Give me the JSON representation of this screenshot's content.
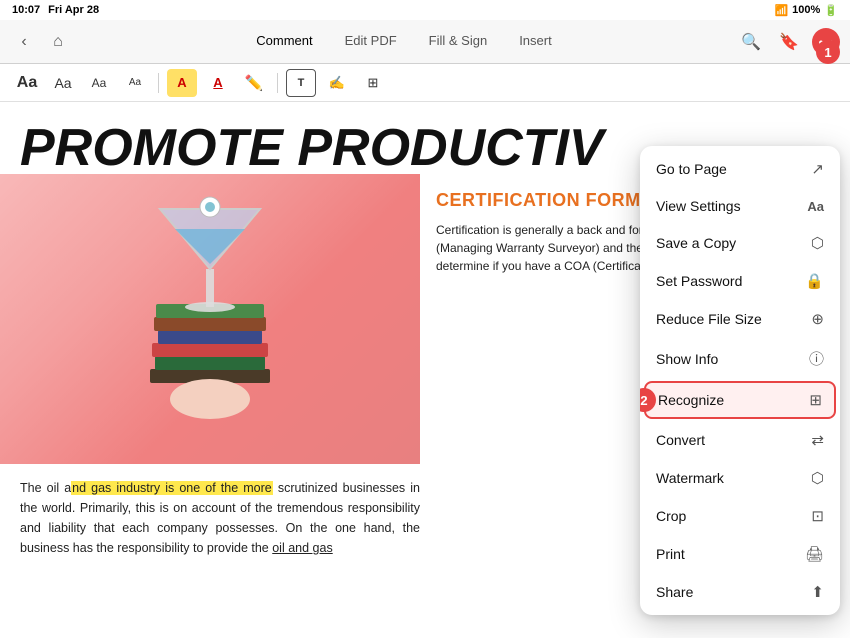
{
  "statusBar": {
    "time": "10:07",
    "day": "Fri Apr 28",
    "battery": "100%",
    "batteryIcon": "🔋"
  },
  "toolbar": {
    "tabs": [
      {
        "id": "comment",
        "label": "Comment",
        "active": true
      },
      {
        "id": "editpdf",
        "label": "Edit PDF",
        "active": false
      },
      {
        "id": "fillsign",
        "label": "Fill & Sign",
        "active": false
      },
      {
        "id": "insert",
        "label": "Insert",
        "active": false
      }
    ],
    "moreButton": "•••"
  },
  "formatBar": {
    "buttons": [
      {
        "id": "aa-large",
        "label": "Aa",
        "size": "large"
      },
      {
        "id": "aa-med",
        "label": "Aa",
        "size": "medium"
      },
      {
        "id": "aa-small",
        "label": "Aa",
        "size": "small"
      },
      {
        "id": "aa-xs",
        "label": "Aa",
        "size": "xsmall"
      },
      {
        "id": "highlight-red",
        "label": "A",
        "type": "color"
      },
      {
        "id": "underline-red",
        "label": "A̲",
        "type": "underline"
      },
      {
        "id": "pencil",
        "label": "✏",
        "type": "draw"
      },
      {
        "id": "text-box",
        "label": "T",
        "type": "textbox"
      },
      {
        "id": "signature",
        "label": "✍",
        "type": "signature"
      },
      {
        "id": "image",
        "label": "⊞",
        "type": "image"
      }
    ]
  },
  "pdf": {
    "title": "PROMOTE PRODUCTIV",
    "bodyText": "The oil and gas industry is one of the more scrutinized businesses in the world. Primarily, this is on account of the tremendous responsibility and liability that each company possesses. On the one hand, the business has the responsibility to provide the oil and gas",
    "highlightedText": "nd gas industry is one of the more",
    "certTitle": "CERTIFICATION FORMS",
    "certText": "Certification is generally a back and forth of fixes between the MWS (Managing Warranty Surveyor) and the insurer. Since the MWS will determine if you have a COA (Certificate"
  },
  "menu": {
    "items": [
      {
        "id": "go-to-page",
        "label": "Go to Page",
        "icon": "⤢"
      },
      {
        "id": "view-settings",
        "label": "View Settings",
        "icon": "Aa"
      },
      {
        "id": "save-a-copy",
        "label": "Save a Copy",
        "icon": "⊡"
      },
      {
        "id": "set-password",
        "label": "Set Password",
        "icon": "🔒"
      },
      {
        "id": "reduce-file-size",
        "label": "Reduce File Size",
        "icon": "⊕"
      },
      {
        "id": "show-info",
        "label": "Show Info",
        "icon": "ⓘ"
      },
      {
        "id": "recognize",
        "label": "Recognize",
        "icon": "⊞",
        "highlighted": true
      },
      {
        "id": "convert",
        "label": "Convert",
        "icon": "⇄"
      },
      {
        "id": "watermark",
        "label": "Watermark",
        "icon": "⊡"
      },
      {
        "id": "crop",
        "label": "Crop",
        "icon": "⊡"
      },
      {
        "id": "print",
        "label": "Print",
        "icon": "🖨"
      },
      {
        "id": "share",
        "label": "Share",
        "icon": "⬆"
      }
    ]
  },
  "badges": {
    "badge1": "1",
    "badge2": "2"
  }
}
